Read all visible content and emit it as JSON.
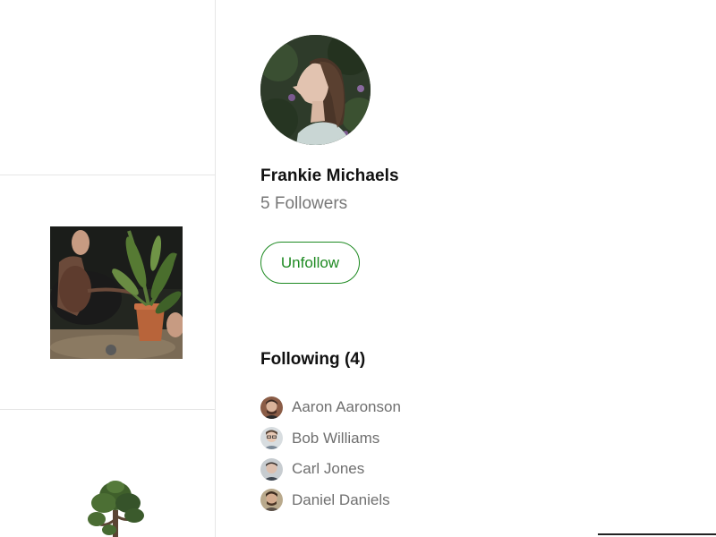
{
  "profile": {
    "name": "Frankie Michaels",
    "followers_text": "5 Followers",
    "unfollow_label": "Unfollow"
  },
  "following": {
    "title": "Following",
    "count_text": "(4)",
    "items": [
      {
        "name": "Aaron Aaronson"
      },
      {
        "name": "Bob Williams"
      },
      {
        "name": "Carl Jones"
      },
      {
        "name": "Daniel Daniels"
      }
    ]
  },
  "colors": {
    "accent": "#1e8a22",
    "muted_text": "#777777",
    "divider": "#e6e6e6"
  }
}
